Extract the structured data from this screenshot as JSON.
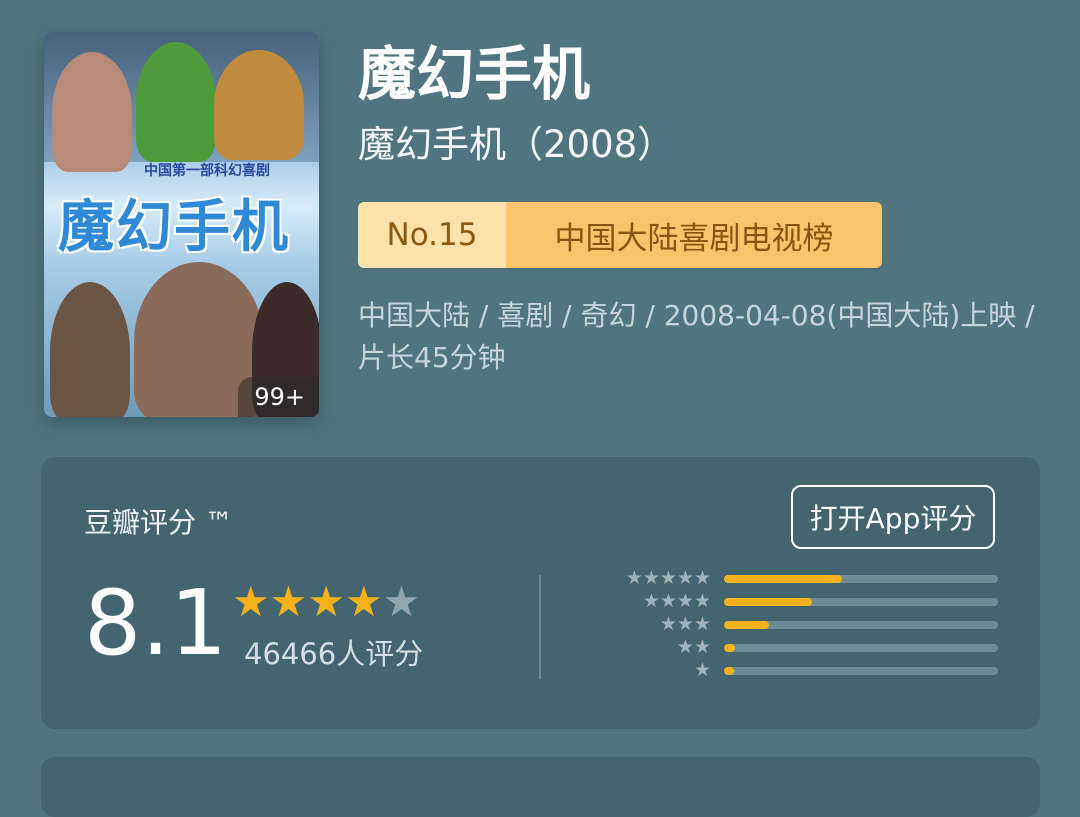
{
  "poster": {
    "tagline": "中国第一部科幻喜剧",
    "title": "魔幻手机",
    "count_badge": "99+"
  },
  "title": "魔幻手机",
  "subtitle": "魔幻手机（2008）",
  "rank": {
    "number": "No.15",
    "list_name": "中国大陆喜剧电视榜"
  },
  "meta_info": "中国大陆 / 喜剧 / 奇幻 / 2008-04-08(中国大陆)上映 / 片长45分钟",
  "rating": {
    "label": "豆瓣评分 ™",
    "open_app_label": "打开App评分",
    "score": "8.1",
    "stars_filled": 4,
    "stars_total": 5,
    "raters": "46466人评分",
    "distribution": [
      {
        "stars": "★★★★★",
        "fraction": 0.43
      },
      {
        "stars": "★★★★",
        "fraction": 0.32
      },
      {
        "stars": "★★★",
        "fraction": 0.165
      },
      {
        "stars": "★★",
        "fraction": 0.04
      },
      {
        "stars": "★",
        "fraction": 0.035
      }
    ]
  },
  "colors": {
    "background": "#4f7680",
    "card": "#42656f",
    "star": "#f5b21c",
    "rank_no_bg": "#fde3aa",
    "rank_list_bg": "#fbc46a"
  }
}
